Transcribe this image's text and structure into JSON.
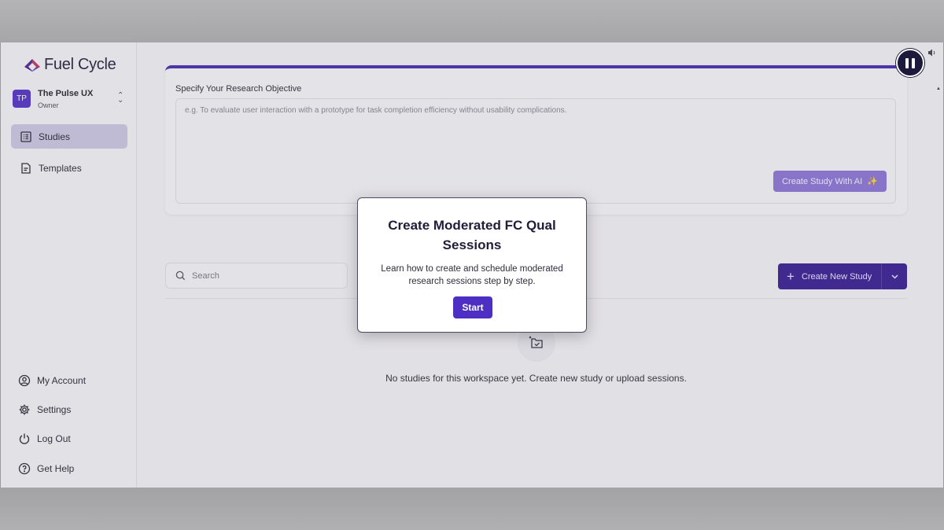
{
  "brand": {
    "name": "Fuel Cycle",
    "accent": "#4a2fb0"
  },
  "workspace": {
    "initials": "TP",
    "name": "The Pulse UX",
    "role": "Owner"
  },
  "sidebar": {
    "items": [
      {
        "label": "Studies",
        "icon": "studies-icon",
        "active": true
      },
      {
        "label": "Templates",
        "icon": "templates-icon",
        "active": false
      }
    ],
    "bottom": [
      {
        "label": "My Account",
        "icon": "account-icon"
      },
      {
        "label": "Settings",
        "icon": "gear-icon"
      },
      {
        "label": "Log Out",
        "icon": "power-icon"
      },
      {
        "label": "Get Help",
        "icon": "help-icon"
      }
    ]
  },
  "objective": {
    "label": "Specify Your Research Objective",
    "placeholder": "e.g. To evaluate user interaction with a prototype for task completion efficiency without usability complications.",
    "ai_button": "Create Study With AI"
  },
  "search": {
    "placeholder": "Search"
  },
  "create_button": {
    "label": "Create New Study"
  },
  "empty_state": {
    "text": "No studies for this workspace yet. Create new study or upload sessions."
  },
  "modal": {
    "title": "Create Moderated FC Qual Sessions",
    "description": "Learn how to create and schedule moderated research sessions step by step.",
    "button": "Start"
  }
}
